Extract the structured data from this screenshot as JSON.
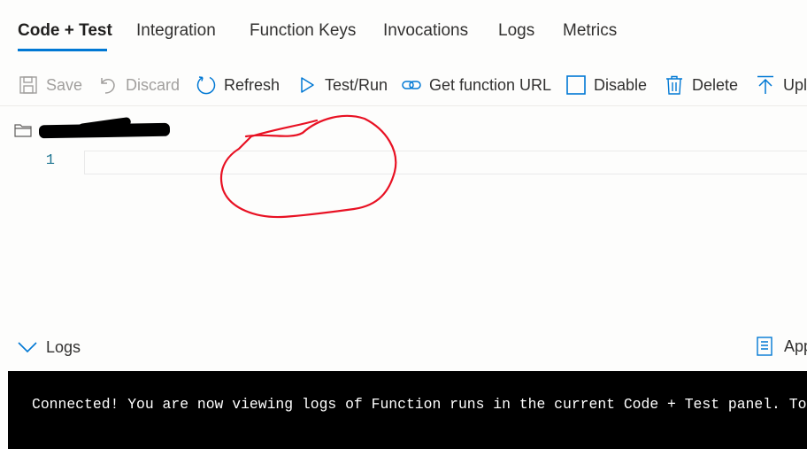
{
  "tabs": [
    {
      "label": "Code + Test",
      "active": true
    },
    {
      "label": "Integration"
    },
    {
      "label": "Function Keys"
    },
    {
      "label": "Invocations"
    },
    {
      "label": "Logs"
    },
    {
      "label": "Metrics"
    }
  ],
  "toolbar": {
    "save": "Save",
    "discard": "Discard",
    "refresh": "Refresh",
    "test_run": "Test/Run",
    "get_function_url": "Get function URL",
    "disable": "Disable",
    "delete": "Delete",
    "upload": "Upl"
  },
  "editor": {
    "line_number": "1",
    "file_path_redacted": true
  },
  "logs": {
    "toggle_label": "Logs",
    "app_insights_label": "App",
    "console_message": "Connected! You are now viewing logs of Function runs in the current Code + Test panel. To s"
  },
  "colors": {
    "accent": "#0078d4",
    "annotation": "#e81123",
    "console_bg": "#000000",
    "console_fg": "#ffffff"
  },
  "icons": [
    "save-icon",
    "discard-icon",
    "refresh-icon",
    "play-icon",
    "link-icon",
    "checkbox-icon",
    "trash-icon",
    "upload-icon",
    "folder-icon",
    "chevron-down-icon",
    "app-insights-icon"
  ]
}
